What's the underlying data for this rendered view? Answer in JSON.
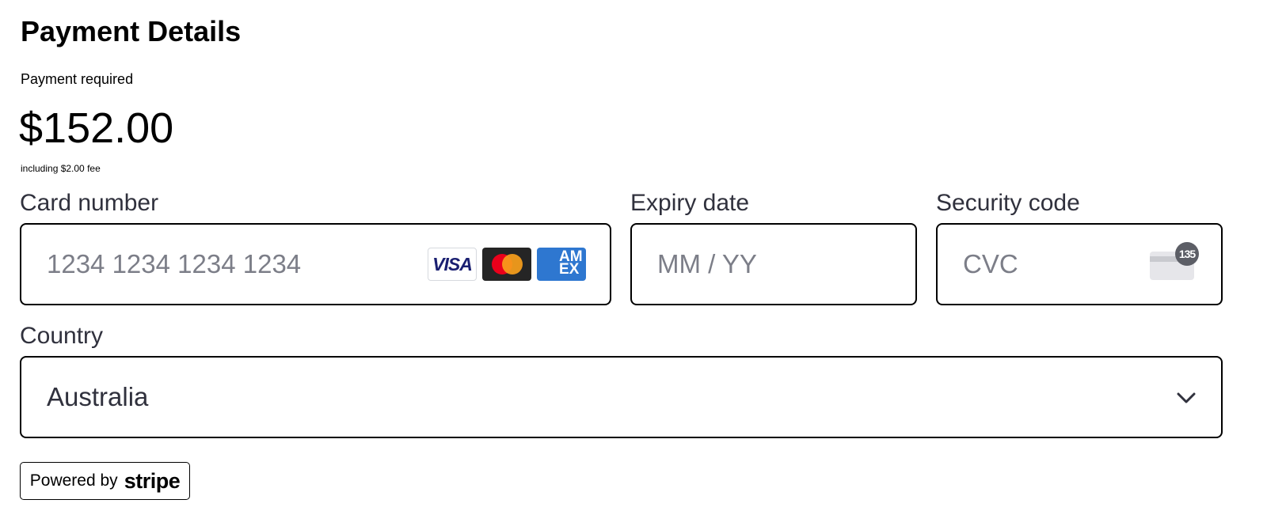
{
  "header": {
    "title": "Payment Details",
    "required_label": "Payment required",
    "amount": "$152.00",
    "fee_note": "including $2.00 fee"
  },
  "form": {
    "card_number": {
      "label": "Card number",
      "placeholder": "1234 1234 1234 1234",
      "value": ""
    },
    "expiry": {
      "label": "Expiry date",
      "placeholder": "MM / YY",
      "value": ""
    },
    "security_code": {
      "label": "Security code",
      "placeholder": "CVC",
      "value": "",
      "icon_badge": "135"
    },
    "country": {
      "label": "Country",
      "selected": "Australia"
    }
  },
  "card_brands": [
    {
      "name": "visa-icon",
      "text": "VISA"
    },
    {
      "name": "mastercard-icon"
    },
    {
      "name": "amex-icon",
      "text": "AM EX"
    }
  ],
  "footer": {
    "powered_by": "Powered by",
    "brand": "stripe"
  },
  "colors": {
    "text": "#30313d",
    "placeholder": "#7c7e88",
    "border": "#000000",
    "visa": "#1a1f71",
    "mastercard_red": "#eb001b",
    "mastercard_yellow": "#f79e1b",
    "amex": "#2e77d0"
  }
}
